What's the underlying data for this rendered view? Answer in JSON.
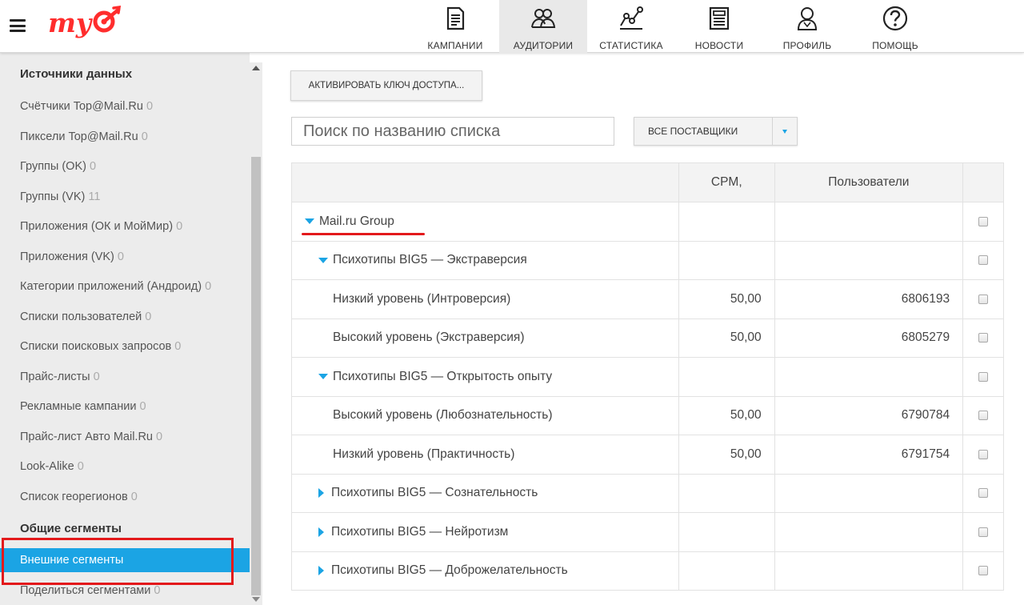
{
  "header": {
    "nav": [
      {
        "label": "КАМПАНИИ",
        "icon": "campaigns-icon"
      },
      {
        "label": "АУДИТОРИИ",
        "icon": "audiences-icon",
        "active": true
      },
      {
        "label": "СТАТИСТИКА",
        "icon": "statistics-icon"
      },
      {
        "label": "НОВОСТИ",
        "icon": "news-icon"
      },
      {
        "label": "ПРОФИЛЬ",
        "icon": "profile-icon"
      },
      {
        "label": "ПОМОЩЬ",
        "icon": "help-icon"
      }
    ],
    "logo_color": "#ff2d2d"
  },
  "sidebar": {
    "section1_title": "Источники данных",
    "items": [
      {
        "label": "Счётчики Top@Mail.Ru",
        "count": "0"
      },
      {
        "label": "Пиксели Top@Mail.Ru",
        "count": "0"
      },
      {
        "label": "Группы (OK)",
        "count": "0"
      },
      {
        "label": "Группы (VK)",
        "count": "11"
      },
      {
        "label": "Приложения (ОК и МойМир)",
        "count": "0"
      },
      {
        "label": "Приложения (VK)",
        "count": "0"
      },
      {
        "label": "Категории приложений (Андроид)",
        "count": "0"
      },
      {
        "label": "Списки пользователей",
        "count": "0"
      },
      {
        "label": "Списки поисковых запросов",
        "count": "0"
      },
      {
        "label": "Прайс-листы",
        "count": "0"
      },
      {
        "label": "Рекламные кампании",
        "count": "0"
      },
      {
        "label": "Прайс-лист Авто Mail.Ru",
        "count": "0"
      },
      {
        "label": "Look-Alike",
        "count": "0"
      },
      {
        "label": "Список георегионов",
        "count": "0"
      }
    ],
    "section2_title": "Общие сегменты",
    "items2": [
      {
        "label": "Внешние сегменты",
        "count": ""
      },
      {
        "label": "Поделиться сегментами",
        "count": "0"
      }
    ],
    "accent_color": "#1ba4e4"
  },
  "main": {
    "activate_button": "АКТИВИРОВАТЬ КЛЮЧ ДОСТУПА...",
    "search_placeholder": "Поиск по названию списка",
    "provider_select": "ВСЕ ПОСТАВЩИКИ",
    "table": {
      "columns": [
        "",
        "CPM,",
        "Пользователи",
        ""
      ],
      "rows": [
        {
          "name": "Mail.ru Group",
          "level": 0,
          "toggle": "expanded",
          "cpm": "",
          "users": ""
        },
        {
          "name": "Психотипы BIG5 — Экстраверсия",
          "level": 1,
          "toggle": "expanded",
          "cpm": "",
          "users": ""
        },
        {
          "name": "Низкий уровень (Интроверсия)",
          "level": 2,
          "toggle": "none",
          "cpm": "50,00",
          "users": "6806193"
        },
        {
          "name": "Высокий уровень (Экстраверсия)",
          "level": 2,
          "toggle": "none",
          "cpm": "50,00",
          "users": "6805279"
        },
        {
          "name": "Психотипы BIG5 — Открытость опыту",
          "level": 1,
          "toggle": "expanded",
          "cpm": "",
          "users": ""
        },
        {
          "name": "Высокий уровень (Любознательность)",
          "level": 2,
          "toggle": "none",
          "cpm": "50,00",
          "users": "6790784"
        },
        {
          "name": "Низкий уровень (Практичность)",
          "level": 2,
          "toggle": "none",
          "cpm": "50,00",
          "users": "6791754"
        },
        {
          "name": "Психотипы BIG5 — Сознательность",
          "level": 1,
          "toggle": "collapsed",
          "cpm": "",
          "users": ""
        },
        {
          "name": "Психотипы BIG5 — Нейротизм",
          "level": 1,
          "toggle": "collapsed",
          "cpm": "",
          "users": ""
        },
        {
          "name": "Психотипы BIG5 — Доброжелательность",
          "level": 1,
          "toggle": "collapsed",
          "cpm": "",
          "users": ""
        }
      ]
    }
  }
}
